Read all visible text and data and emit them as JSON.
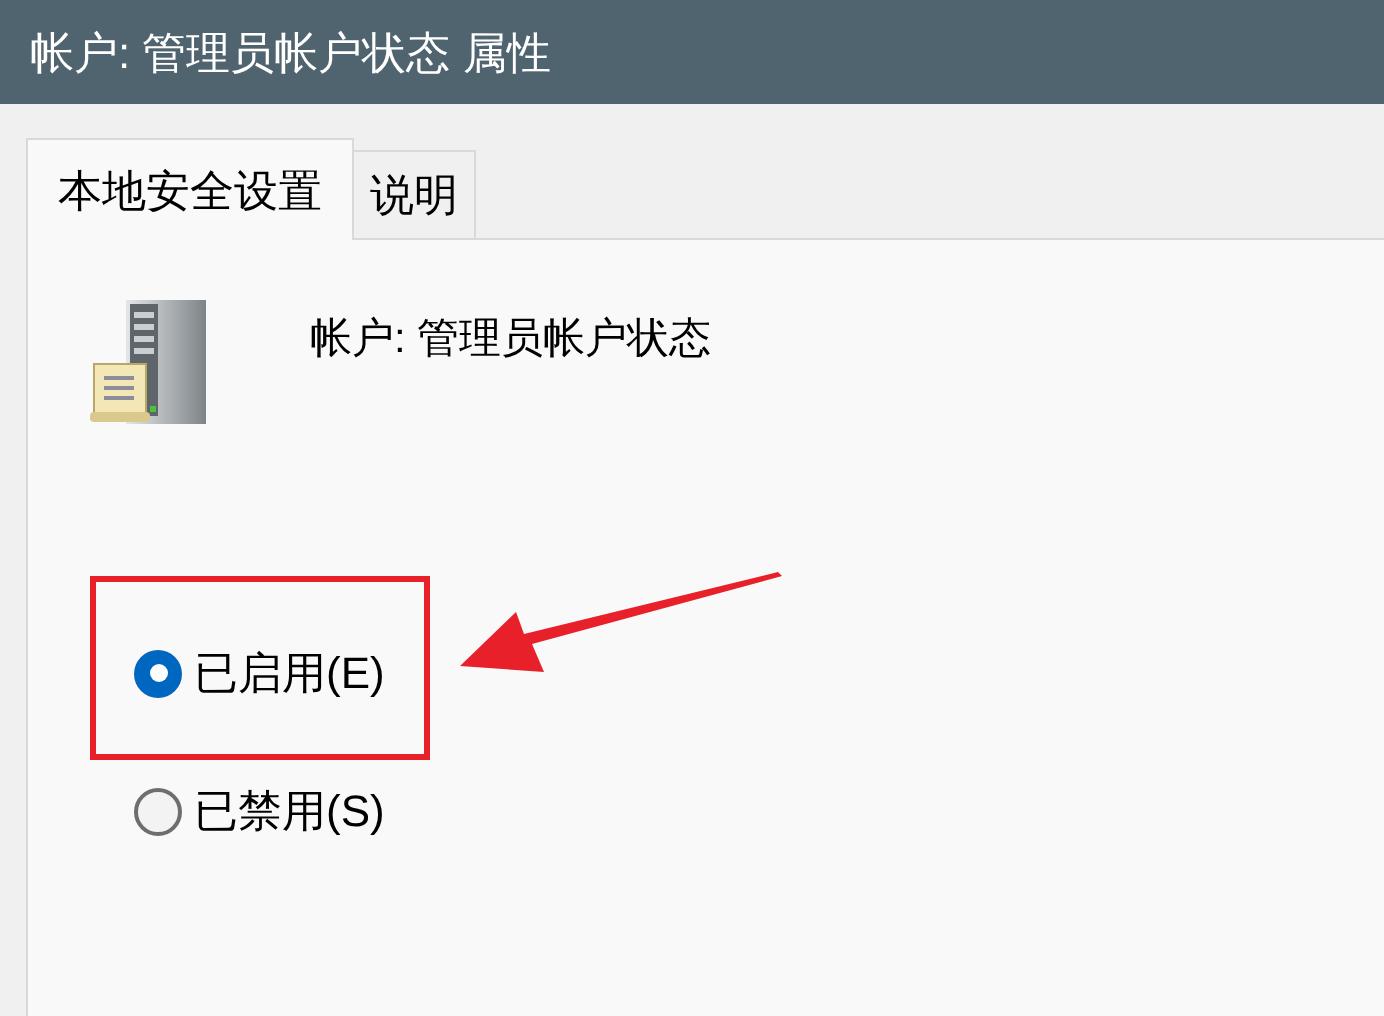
{
  "window": {
    "title": "帐户: 管理员帐户状态 属性"
  },
  "tabs": [
    {
      "label": "本地安全设置",
      "selected": true
    },
    {
      "label": "说明",
      "selected": false
    }
  ],
  "policy": {
    "name": "帐户: 管理员帐户状态"
  },
  "options": [
    {
      "label": "已启用(E)",
      "selected": true,
      "highlighted": true
    },
    {
      "label": "已禁用(S)",
      "selected": false,
      "highlighted": false
    }
  ]
}
